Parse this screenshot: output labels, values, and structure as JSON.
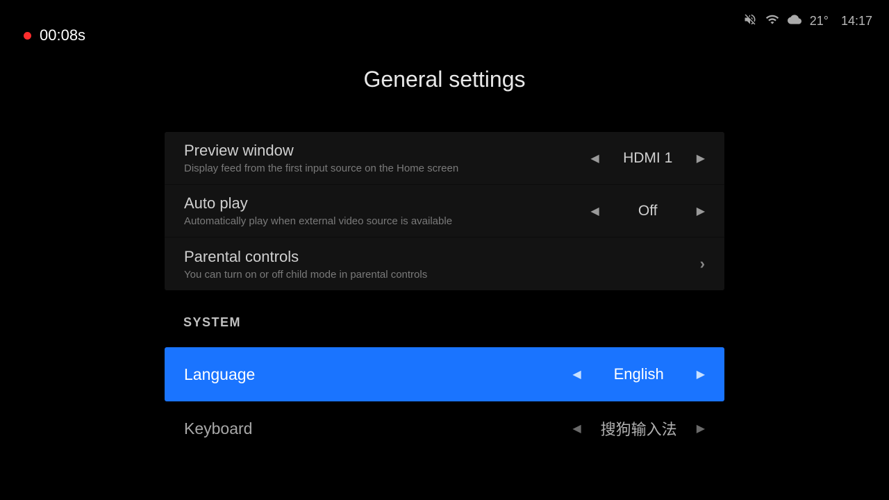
{
  "statusBar": {
    "temperature": "21°",
    "time": "14:17"
  },
  "recording": {
    "time": "00:08s"
  },
  "title": "General settings",
  "group1": {
    "items": [
      {
        "title": "Preview window",
        "desc": "Display feed from the first input source on the Home screen",
        "value": "HDMI 1",
        "type": "selector"
      },
      {
        "title": "Auto play",
        "desc": "Automatically play when external video source is available",
        "value": "Off",
        "type": "selector"
      },
      {
        "title": "Parental controls",
        "desc": "You can turn on or off child mode in parental controls",
        "type": "link"
      }
    ]
  },
  "sectionHeader": "SYSTEM",
  "group2": {
    "items": [
      {
        "title": "Language",
        "value": "English",
        "selected": true
      },
      {
        "title": "Keyboard",
        "value": "搜狗输入法",
        "selected": false
      }
    ]
  }
}
